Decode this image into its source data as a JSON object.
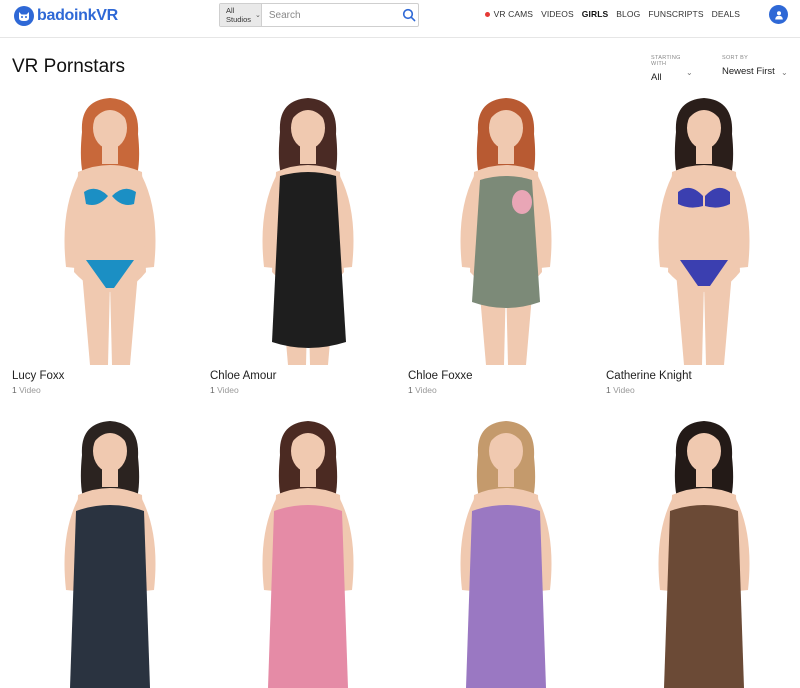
{
  "header": {
    "logo_text": "badoink",
    "logo_suffix": "VR",
    "brand_color": "#2e68d6",
    "studio_select": "All Studios",
    "search_placeholder": "Search",
    "nav": [
      {
        "label": "VR CAMS",
        "live": true
      },
      {
        "label": "VIDEOS"
      },
      {
        "label": "GIRLS",
        "active": true
      },
      {
        "label": "BLOG"
      },
      {
        "label": "FUNSCRIPTS"
      },
      {
        "label": "DEALS"
      }
    ]
  },
  "page": {
    "title": "VR Pornstars",
    "starting_with_label": "STARTING WITH",
    "starting_with_value": "All",
    "sort_by_label": "SORT BY",
    "sort_by_value": "Newest First"
  },
  "models": [
    {
      "name": "Lucy Foxx",
      "count": "1",
      "count_label": "Video",
      "hair": "#c8683a",
      "outfit": "#1b8fc4",
      "style": "bikini"
    },
    {
      "name": "Chloe Amour",
      "count": "1",
      "count_label": "Video",
      "hair": "#4a2a24",
      "outfit": "#1e1e1e",
      "style": "dress"
    },
    {
      "name": "Chloe Foxxe",
      "count": "1",
      "count_label": "Video",
      "hair": "#b85a32",
      "outfit": "#7c8a78",
      "style": "slip"
    },
    {
      "name": "Catherine Knight",
      "count": "1",
      "count_label": "Video",
      "hair": "#2a1e1a",
      "outfit": "#3b3fb0",
      "style": "lingerie"
    },
    {
      "name": "",
      "count": "",
      "count_label": "",
      "hair": "#2b2320",
      "outfit": "#2a3340",
      "style": "top"
    },
    {
      "name": "",
      "count": "",
      "count_label": "",
      "hair": "#4b2a22",
      "outfit": "#e58ba6",
      "style": "top"
    },
    {
      "name": "",
      "count": "",
      "count_label": "",
      "hair": "#c49a6c",
      "outfit": "#9a78c2",
      "style": "top"
    },
    {
      "name": "",
      "count": "",
      "count_label": "",
      "hair": "#231a17",
      "outfit": "#6b4a36",
      "style": "top"
    }
  ]
}
